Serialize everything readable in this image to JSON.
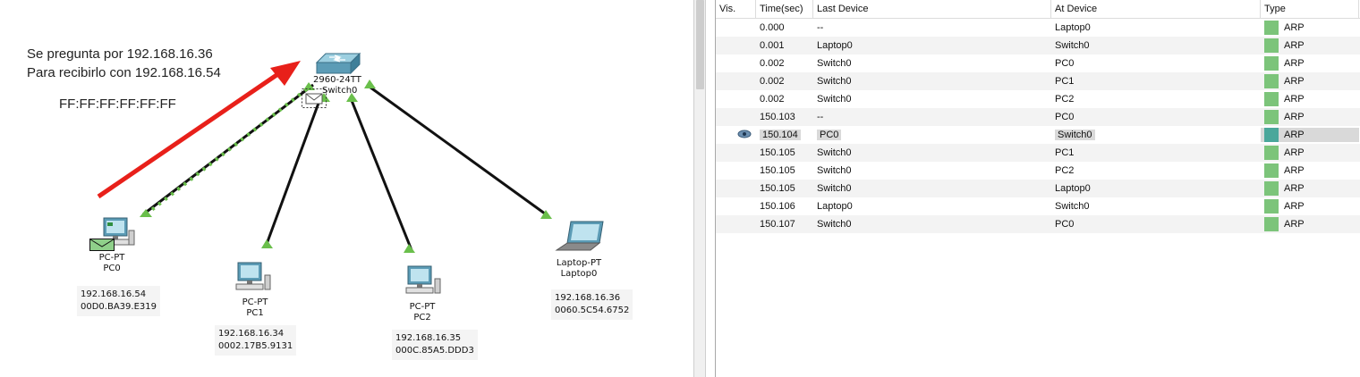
{
  "colors": {
    "link": "#111111",
    "port_up": "#6abf4b",
    "arrow": "#e8201a",
    "arp_swatch": "#7cc47a",
    "arp_swatch_selected": "#4aa79b"
  },
  "topology": {
    "annotations": {
      "line1": "Se pregunta por 192.168.16.36",
      "line2": "Para recibirlo con 192.168.16.54",
      "mac": "FF:FF:FF:FF:FF:FF"
    },
    "switch": {
      "model": "2960-24TT",
      "name": "Switch0",
      "icon": "switch-icon"
    },
    "devices": [
      {
        "model": "PC-PT",
        "name": "PC0",
        "ip": "192.168.16.54",
        "mac": "00D0.BA39.E319",
        "icon": "pc-icon"
      },
      {
        "model": "PC-PT",
        "name": "PC1",
        "ip": "192.168.16.34",
        "mac": "0002.17B5.9131",
        "icon": "pc-icon"
      },
      {
        "model": "PC-PT",
        "name": "PC2",
        "ip": "192.168.16.35",
        "mac": "000C.85A5.DDD3",
        "icon": "pc-icon"
      },
      {
        "model": "Laptop-PT",
        "name": "Laptop0",
        "ip": "192.168.16.36",
        "mac": "0060.5C54.6752",
        "icon": "laptop-icon"
      }
    ]
  },
  "event_list": {
    "headers": {
      "vis": "Vis.",
      "time": "Time(sec)",
      "last": "Last Device",
      "at": "At Device",
      "type": "Type"
    },
    "rows": [
      {
        "time": "0.000",
        "last": "--",
        "at": "Laptop0",
        "type": "ARP"
      },
      {
        "time": "0.001",
        "last": "Laptop0",
        "at": "Switch0",
        "type": "ARP"
      },
      {
        "time": "0.002",
        "last": "Switch0",
        "at": "PC0",
        "type": "ARP"
      },
      {
        "time": "0.002",
        "last": "Switch0",
        "at": "PC1",
        "type": "ARP"
      },
      {
        "time": "0.002",
        "last": "Switch0",
        "at": "PC2",
        "type": "ARP"
      },
      {
        "time": "150.103",
        "last": "--",
        "at": "PC0",
        "type": "ARP"
      },
      {
        "time": "150.104",
        "last": "PC0",
        "at": "Switch0",
        "type": "ARP",
        "selected": true,
        "vis_icon": "eye-icon"
      },
      {
        "time": "150.105",
        "last": "Switch0",
        "at": "PC1",
        "type": "ARP"
      },
      {
        "time": "150.105",
        "last": "Switch0",
        "at": "PC2",
        "type": "ARP"
      },
      {
        "time": "150.105",
        "last": "Switch0",
        "at": "Laptop0",
        "type": "ARP"
      },
      {
        "time": "150.106",
        "last": "Laptop0",
        "at": "Switch0",
        "type": "ARP"
      },
      {
        "time": "150.107",
        "last": "Switch0",
        "at": "PC0",
        "type": "ARP"
      }
    ]
  }
}
